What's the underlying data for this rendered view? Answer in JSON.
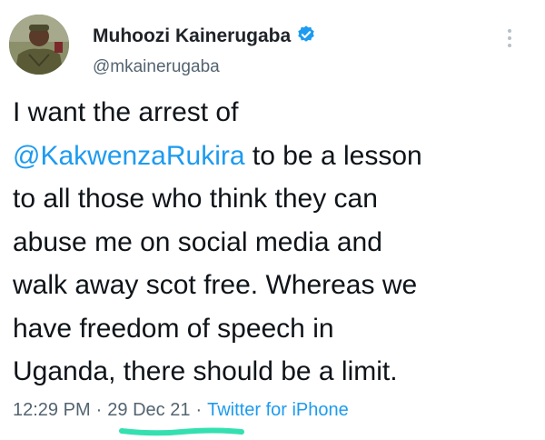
{
  "author": {
    "name": "Muhoozi Kainerugaba",
    "handle": "@mkainerugaba",
    "verified": true,
    "avatar_icon": "profile-photo-military-uniform"
  },
  "tweet": {
    "text_before_mention": "I want the arrest of",
    "mention": "@KakwenzaRukira",
    "text_after_mention_line1": " to be a lesson",
    "lines": [
      "to all those who think they can",
      "abuse me on social media and",
      "walk away scot free. Whereas we",
      "have freedom of speech in",
      "Uganda, there should be a limit."
    ]
  },
  "meta": {
    "time": "12:29 PM",
    "separator": "·",
    "date": "29 Dec 21",
    "source": "Twitter for iPhone"
  },
  "colors": {
    "link": "#1d9bf0",
    "secondary_text": "#536471",
    "highlight_underline": "#35e0b0"
  }
}
